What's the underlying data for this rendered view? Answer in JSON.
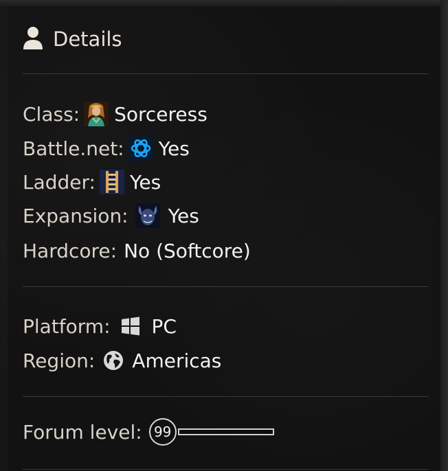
{
  "header": {
    "title": "Details",
    "icon": "user-icon"
  },
  "details": {
    "class_label": "Class:",
    "class_value": "Sorceress",
    "battlenet_label": "Battle.net:",
    "battlenet_value": "Yes",
    "ladder_label": "Ladder:",
    "ladder_value": "Yes",
    "expansion_label": "Expansion:",
    "expansion_value": "Yes",
    "hardcore_label": "Hardcore:",
    "hardcore_value": "No (Softcore)"
  },
  "system": {
    "platform_label": "Platform:",
    "platform_value": "PC",
    "region_label": "Region:",
    "region_value": "Americas"
  },
  "forum": {
    "level_label": "Forum level:",
    "level_value": "99",
    "progress_fraction": 0.0
  },
  "colors": {
    "label": "#d9d2c8",
    "value": "#f2f2f2",
    "divider": "#3a3a3a",
    "battlenet_accent": "#1aa6ff"
  }
}
